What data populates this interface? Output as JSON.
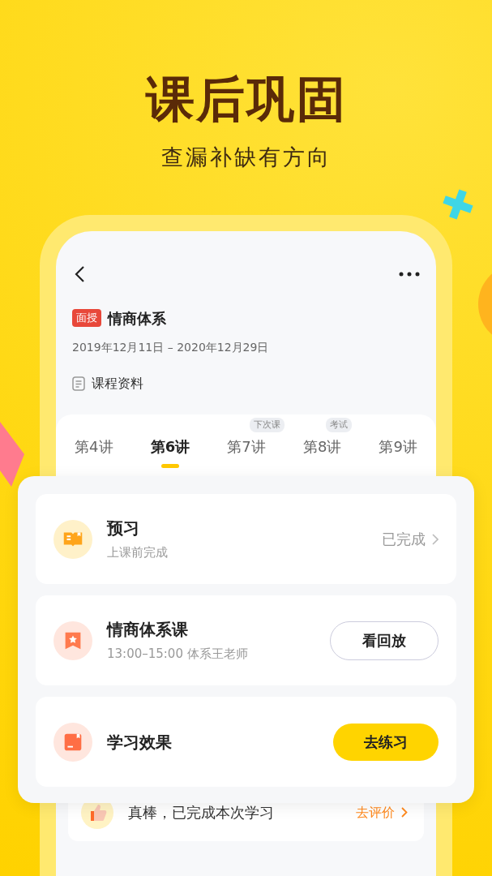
{
  "hero": {
    "title": "课后巩固",
    "subtitle": "查漏补缺有方向"
  },
  "screen": {
    "course_tag": "面授",
    "course_title": "情商体系",
    "date_range": "2019年12月11日 – 2020年12月29日",
    "materials_link": "课程资料",
    "tabs": [
      {
        "label": "第4讲",
        "selected": false
      },
      {
        "label": "第6讲",
        "selected": true
      },
      {
        "label": "第7讲",
        "selected": false,
        "badge": "下次课"
      },
      {
        "label": "第8讲",
        "selected": false,
        "badge": "考试"
      },
      {
        "label": "第9讲",
        "selected": false
      }
    ],
    "tasks": [
      {
        "kind": "preview",
        "title": "预习",
        "subtitle": "上课前完成",
        "status": "已完成"
      },
      {
        "kind": "lesson",
        "title": "情商体系课",
        "subtitle": "13:00–15:00 体系王老师",
        "action": "看回放"
      },
      {
        "kind": "practice",
        "title": "学习效果",
        "action": "去练习"
      }
    ],
    "completion": {
      "message": "真棒，已完成本次学习",
      "action": "去评价"
    }
  }
}
